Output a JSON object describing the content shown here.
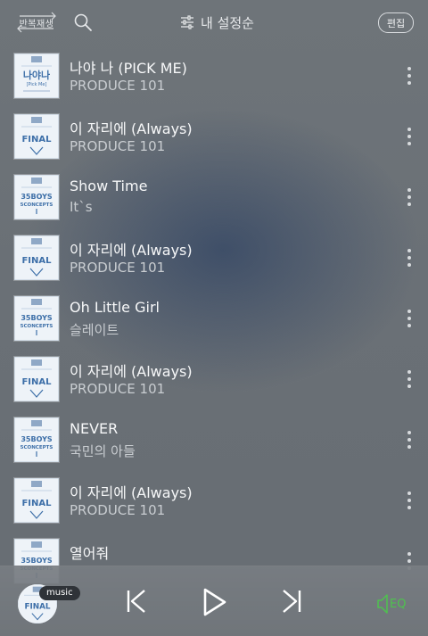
{
  "topbar": {
    "repeat_label": "반복재생",
    "sort_label": "내 설정순",
    "edit_label": "편집"
  },
  "songs": [
    {
      "title": "나야 나 (PICK ME)",
      "artist": "PRODUCE 101",
      "art": "pickme"
    },
    {
      "title": "이 자리에 (Always)",
      "artist": "PRODUCE 101",
      "art": "final"
    },
    {
      "title": "Show Time",
      "artist": "It`s",
      "art": "35boys"
    },
    {
      "title": "이 자리에 (Always)",
      "artist": "PRODUCE 101",
      "art": "final"
    },
    {
      "title": "Oh Little Girl",
      "artist": "슬레이트",
      "art": "35boys"
    },
    {
      "title": "이 자리에 (Always)",
      "artist": "PRODUCE 101",
      "art": "final"
    },
    {
      "title": "NEVER",
      "artist": "국민의 아들",
      "art": "35boys"
    },
    {
      "title": "이 자리에 (Always)",
      "artist": "PRODUCE 101",
      "art": "final"
    },
    {
      "title": "열어줘",
      "artist": "",
      "art": "35boys"
    }
  ],
  "album_art_text": {
    "pickme": "나야나",
    "pickme_sub": "[Pick Me]",
    "final": "FINAL",
    "boys_line1": "35BOYS",
    "boys_line2": "5CONCEPTS"
  },
  "player": {
    "badge_label": "music",
    "eq_label": "EQ",
    "accent": "#4ec24e",
    "now_playing_art": "final"
  }
}
